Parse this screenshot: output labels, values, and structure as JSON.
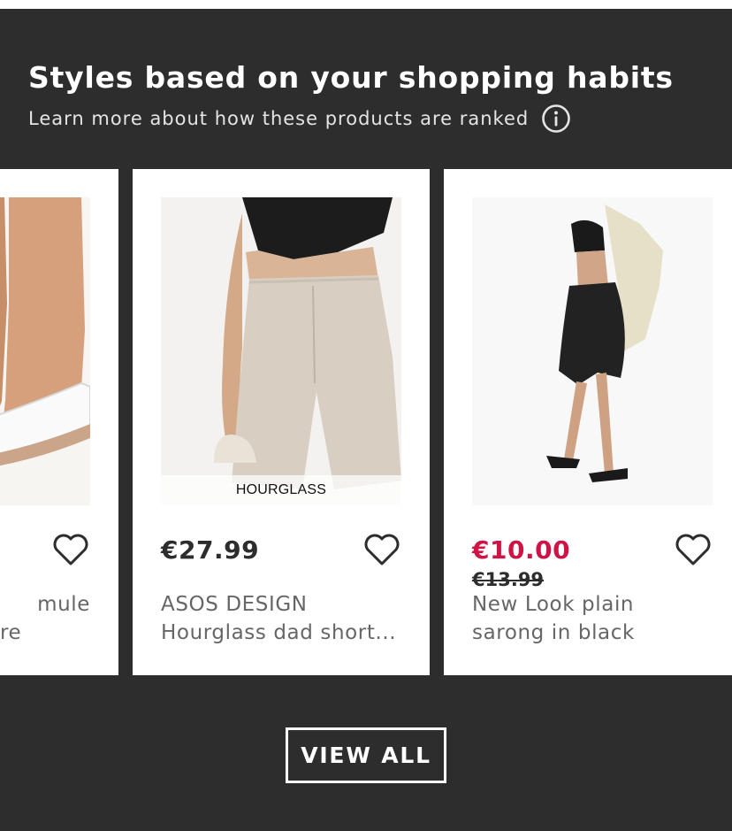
{
  "section": {
    "title": "Styles based on your shopping habits",
    "subtitle": "Learn more about how these products are ranked",
    "info_icon": "info-circle-icon"
  },
  "products": [
    {
      "price": "",
      "name_line1": "mule",
      "name_line2": "re",
      "image": "white-strap-mule-sandal",
      "wishlist_icon": "heart-outline-icon"
    },
    {
      "price": "€27.99",
      "name_line1": "ASOS DESIGN",
      "name_line2": "Hourglass dad short...",
      "brand_label": "HOURGLASS",
      "image": "linen-dad-shorts",
      "wishlist_icon": "heart-outline-icon"
    },
    {
      "price": "€10.00",
      "price_was": "€13.99",
      "name_line1": "New Look plain",
      "name_line2": "sarong in black",
      "image": "black-sarong",
      "wishlist_icon": "heart-outline-icon"
    }
  ],
  "view_all_label": "VIEW ALL",
  "colors": {
    "panel_background": "#2d2d2d",
    "card_background": "#ffffff",
    "sale_price": "#d01345",
    "price": "#2d2d2d",
    "product_name": "#666666"
  }
}
